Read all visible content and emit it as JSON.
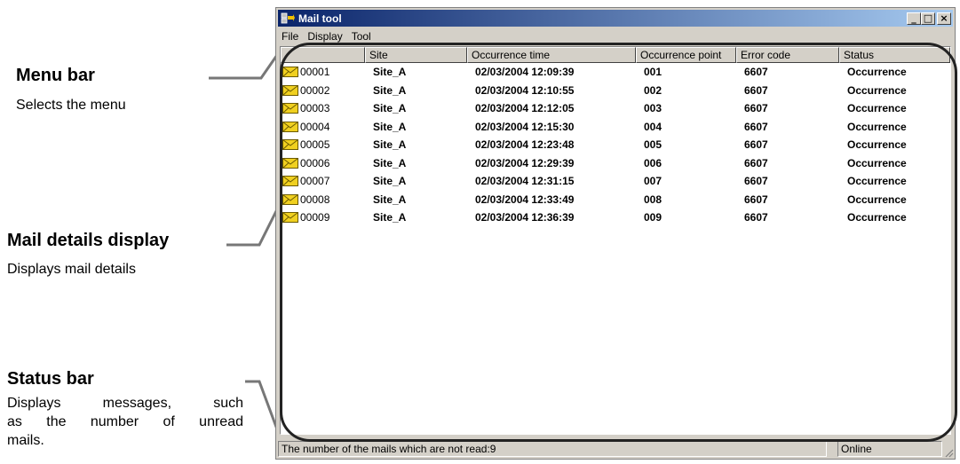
{
  "annotations": {
    "menu_bar": {
      "title": "Menu bar",
      "desc": "Selects the menu"
    },
    "mail_details": {
      "title": "Mail details display",
      "desc": "Displays mail details"
    },
    "status_bar": {
      "title": "Status bar",
      "desc_lines": [
        "Displays messages, such",
        "as the number of unread",
        "mails."
      ]
    }
  },
  "window": {
    "title": "Mail tool",
    "controls": {
      "minimize": "_",
      "maximize": "□",
      "close": "×"
    }
  },
  "menu": [
    "File",
    "Display",
    "Tool"
  ],
  "table": {
    "columns": [
      "",
      "Site",
      "Occurrence time",
      "Occurrence point",
      "Error code",
      "Status"
    ],
    "rows": [
      {
        "id": "00001",
        "site": "Site_A",
        "time": "02/03/2004 12:09:39",
        "point": "001",
        "code": "6607",
        "status": "Occurrence"
      },
      {
        "id": "00002",
        "site": "Site_A",
        "time": "02/03/2004 12:10:55",
        "point": "002",
        "code": "6607",
        "status": "Occurrence"
      },
      {
        "id": "00003",
        "site": "Site_A",
        "time": "02/03/2004 12:12:05",
        "point": "003",
        "code": "6607",
        "status": "Occurrence"
      },
      {
        "id": "00004",
        "site": "Site_A",
        "time": "02/03/2004 12:15:30",
        "point": "004",
        "code": "6607",
        "status": "Occurrence"
      },
      {
        "id": "00005",
        "site": "Site_A",
        "time": "02/03/2004 12:23:48",
        "point": "005",
        "code": "6607",
        "status": "Occurrence"
      },
      {
        "id": "00006",
        "site": "Site_A",
        "time": "02/03/2004 12:29:39",
        "point": "006",
        "code": "6607",
        "status": "Occurrence"
      },
      {
        "id": "00007",
        "site": "Site_A",
        "time": "02/03/2004 12:31:15",
        "point": "007",
        "code": "6607",
        "status": "Occurrence"
      },
      {
        "id": "00008",
        "site": "Site_A",
        "time": "02/03/2004 12:33:49",
        "point": "008",
        "code": "6607",
        "status": "Occurrence"
      },
      {
        "id": "00009",
        "site": "Site_A",
        "time": "02/03/2004 12:36:39",
        "point": "009",
        "code": "6607",
        "status": "Occurrence"
      }
    ],
    "row_icon": "mail-envelope-icon"
  },
  "statusbar": {
    "message": "The number of the mails which are not read:9",
    "state": "Online"
  },
  "colors": {
    "titlebar_start": "#0a246a",
    "titlebar_end": "#a6caf0",
    "envelope": "#f0d020"
  }
}
